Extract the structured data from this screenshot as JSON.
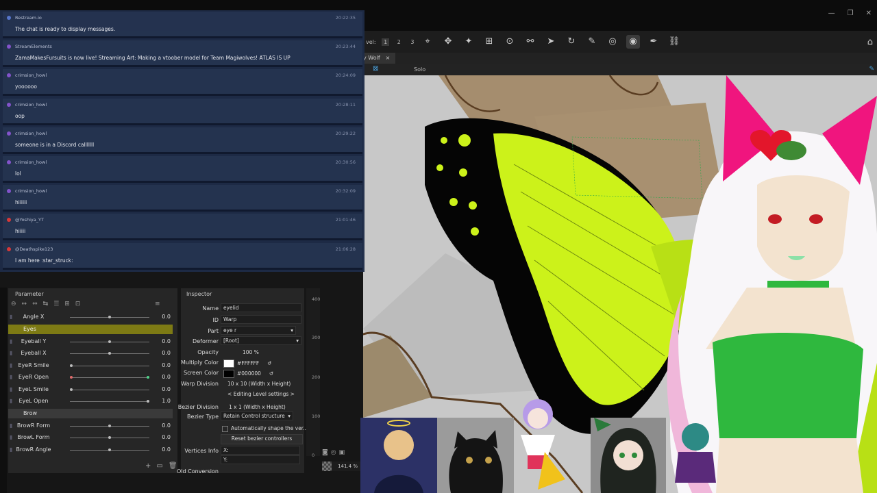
{
  "window": {
    "controls": [
      "—",
      "❐",
      "✕"
    ]
  },
  "toolbar": {
    "level_label": "vel:",
    "levels": [
      "1",
      "2",
      "3"
    ],
    "selected_level": "1",
    "tools": [
      {
        "name": "deform-brush-icon",
        "glyph": "⌖"
      },
      {
        "name": "arrange-icon",
        "glyph": "✥"
      },
      {
        "name": "warp-icon",
        "glyph": "✦"
      },
      {
        "name": "mesh-icon",
        "glyph": "⊞"
      },
      {
        "name": "pin-icon",
        "glyph": "⊙"
      },
      {
        "name": "glue-icon",
        "glyph": "⚯"
      },
      {
        "name": "select-arrow-icon",
        "glyph": "➤"
      },
      {
        "name": "rotate-icon",
        "glyph": "↻"
      },
      {
        "name": "brush-icon",
        "glyph": "✎"
      },
      {
        "name": "view-icon",
        "glyph": "◎"
      },
      {
        "name": "eye-tool-icon",
        "glyph": "◉"
      },
      {
        "name": "pen-icon",
        "glyph": "✒"
      },
      {
        "name": "link-icon",
        "glyph": "⛓"
      }
    ]
  },
  "tab": {
    "label": "y Wolf",
    "close": "×"
  },
  "subbar": {
    "solo": "Solo"
  },
  "chat": {
    "messages": [
      {
        "user": "Restream.io",
        "time": "20:22:35",
        "text": "The chat is ready to display messages.",
        "color": "#5b7bd5"
      },
      {
        "user": "StreamElements",
        "time": "20:23:44",
        "text": "ZamaMakesFursuits is now live! Streaming Art: Making a vtoober model for Team Magiwolves! ATLAS IS UP",
        "color": "#8a57d6"
      },
      {
        "user": "crimsion_howl",
        "time": "20:24:09",
        "text": "yoooooo",
        "color": "#8a57d6"
      },
      {
        "user": "crimsion_howl",
        "time": "20:28:11",
        "text": "oop",
        "color": "#8a57d6"
      },
      {
        "user": "crimsion_howl",
        "time": "20:29:22",
        "text": "someone is in a Discord calllllll",
        "color": "#8a57d6"
      },
      {
        "user": "crimsion_howl",
        "time": "20:30:56",
        "text": "lol",
        "color": "#8a57d6"
      },
      {
        "user": "crimsion_howl",
        "time": "20:32:09",
        "text": "hiiiiii",
        "color": "#8a57d6"
      },
      {
        "user": "@Yoshiya_YT",
        "time": "21:01:46",
        "text": "hiiiii",
        "color": "#e23b3b"
      },
      {
        "user": "@Deathspike123",
        "time": "21:06:28",
        "text": "I am here :star_struck:",
        "color": "#e23b3b"
      }
    ]
  },
  "parameter": {
    "title": "Parameter",
    "rows": [
      {
        "type": "param",
        "label": "Angle X",
        "value": "0.0",
        "knob": 0.5
      },
      {
        "type": "group",
        "label": "Eyes",
        "style": "eyes"
      },
      {
        "type": "param",
        "label": "Eyeball Y",
        "value": "0.0",
        "knob": 0.5
      },
      {
        "type": "param",
        "label": "Eyeball X",
        "value": "0.0",
        "knob": 0.5
      },
      {
        "type": "param",
        "label": "EyeR Smile",
        "value": "0.0",
        "knob": 0.0
      },
      {
        "type": "param",
        "label": "EyeR Open",
        "value": "0.0",
        "knob": 0.0,
        "active": true
      },
      {
        "type": "param",
        "label": "EyeL Smile",
        "value": "0.0",
        "knob": 0.0
      },
      {
        "type": "param",
        "label": "EyeL Open",
        "value": "1.0",
        "knob": 1.0
      },
      {
        "type": "group",
        "label": "Brow",
        "style": "brow"
      },
      {
        "type": "param",
        "label": "BrowR Form",
        "value": "0.0",
        "knob": 0.5
      },
      {
        "type": "param",
        "label": "BrowL Form",
        "value": "0.0",
        "knob": 0.5
      },
      {
        "type": "param",
        "label": "BrowR Angle",
        "value": "0.0",
        "knob": 0.5
      }
    ]
  },
  "inspector": {
    "title": "Inspector",
    "name_label": "Name",
    "name_value": "eyelid",
    "id_label": "ID",
    "id_value": "Warp",
    "part_label": "Part",
    "part_value": "eye r",
    "deformer_label": "Deformer",
    "deformer_value": "[Root]",
    "opacity_label": "Opacity",
    "opacity_value": "100 %",
    "multiply_label": "Multiply Color",
    "multiply_value": "#FFFFFF",
    "multiply_color": "#FFFFFF",
    "screen_label": "Screen Color",
    "screen_value": "#000000",
    "screen_color": "#000000",
    "warp_label": "Warp Division",
    "warp_value": "10  x   10 (Width x Height)",
    "editing_btn": "< Editing Level settings >",
    "bezier_label": "Bezier Division",
    "bezier_value": "1  x    1 (Width x Height)",
    "bezier_type_label": "Bezier Type",
    "bezier_type_value": "Retain Control structure",
    "auto_shape": "Automatically shape the ver...",
    "reset_btn": "Reset bezier controllers",
    "vertices_label": "Vertices Info",
    "vx": "X:",
    "vy": "Y:",
    "old_label": "Old Conversion"
  },
  "ruler": [
    "400",
    "300",
    "200",
    "100",
    "0"
  ],
  "zoom": "141.4 %",
  "colors": {
    "wing_green": "#ccf21a",
    "wing_black": "#050505",
    "ear_pink": "#f0157e",
    "top_green": "#2fb83e",
    "skin": "#f3e3cf"
  }
}
